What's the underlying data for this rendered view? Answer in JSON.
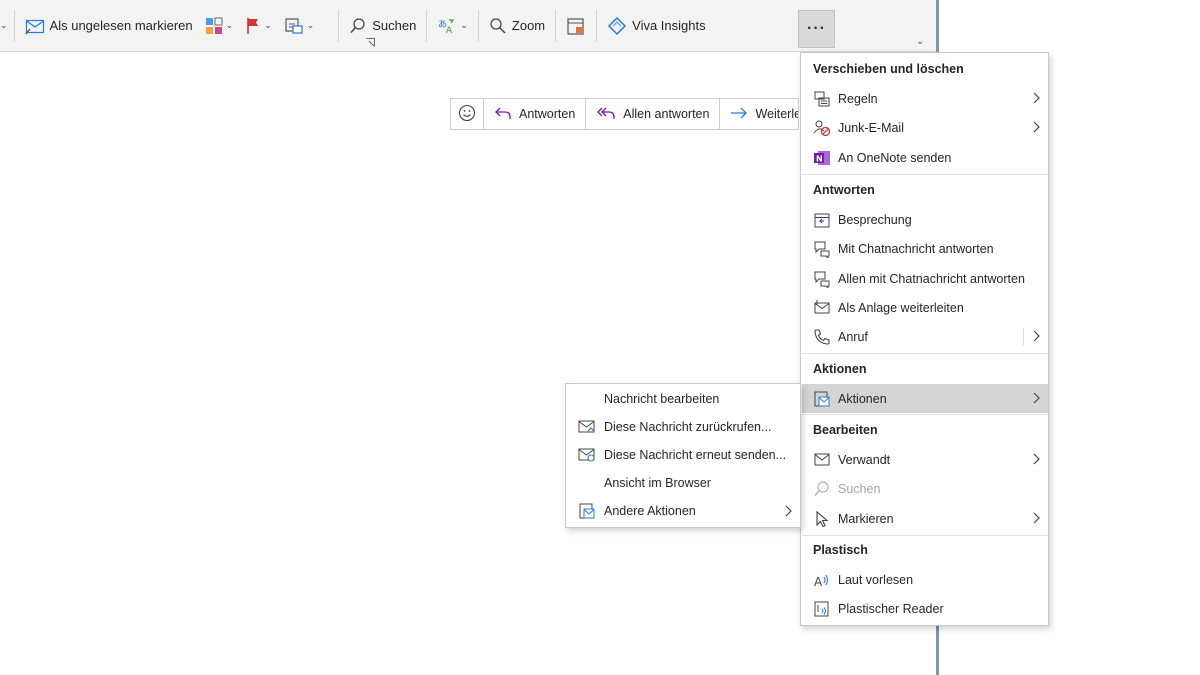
{
  "ribbon": {
    "mark_unread": "Als ungelesen markieren",
    "search": "Suchen",
    "zoom": "Zoom",
    "viva": "Viva Insights",
    "more": "···"
  },
  "reply_bar": {
    "reply": "Antworten",
    "reply_all": "Allen antworten",
    "forward": "Weiterle"
  },
  "menu": {
    "sections": [
      {
        "header": "Verschieben und löschen"
      },
      {
        "header": "Antworten"
      },
      {
        "header": "Aktionen"
      },
      {
        "header": "Bearbeiten"
      },
      {
        "header": "Plastisch"
      }
    ],
    "items": [
      {
        "label": "Regeln",
        "icon": "rules-icon"
      },
      {
        "label": "Junk-E-Mail",
        "icon": "junk-icon"
      },
      {
        "label": "An OneNote senden",
        "icon": "onenote-icon"
      },
      {
        "label": "Besprechung",
        "icon": "meeting-icon"
      },
      {
        "label": "Mit Chatnachricht antworten",
        "icon": "chat-icon"
      },
      {
        "label": "Allen mit Chatnachricht antworten",
        "icon": "chat-icon"
      },
      {
        "label": "Als Anlage weiterleiten",
        "icon": "attachment-forward-icon"
      },
      {
        "label": "Anruf",
        "icon": "phone-icon"
      },
      {
        "label": "Aktionen",
        "icon": "actions-icon"
      },
      {
        "label": "Verwandt",
        "icon": "related-icon"
      },
      {
        "label": "Suchen",
        "icon": "search-icon"
      },
      {
        "label": "Markieren",
        "icon": "cursor-icon"
      },
      {
        "label": "Laut vorlesen",
        "icon": "read-aloud-icon"
      },
      {
        "label": "Plastischer Reader",
        "icon": "immersive-reader-icon"
      }
    ]
  },
  "submenu": {
    "items": [
      {
        "label": "Nachricht bearbeiten"
      },
      {
        "label": "Diese Nachricht zurückrufen...",
        "icon": "recall-icon"
      },
      {
        "label": "Diese Nachricht erneut senden...",
        "icon": "resend-icon"
      },
      {
        "label": "Ansicht im Browser"
      },
      {
        "label": "Andere Aktionen",
        "icon": "actions-icon"
      }
    ]
  },
  "colors": {
    "ribbon_bg": "#f3f3f3",
    "highlight": "#d4d4d4",
    "accent_blue": "#2b79d0",
    "accent_purple": "#7719aa",
    "flag_red": "#d13438"
  }
}
